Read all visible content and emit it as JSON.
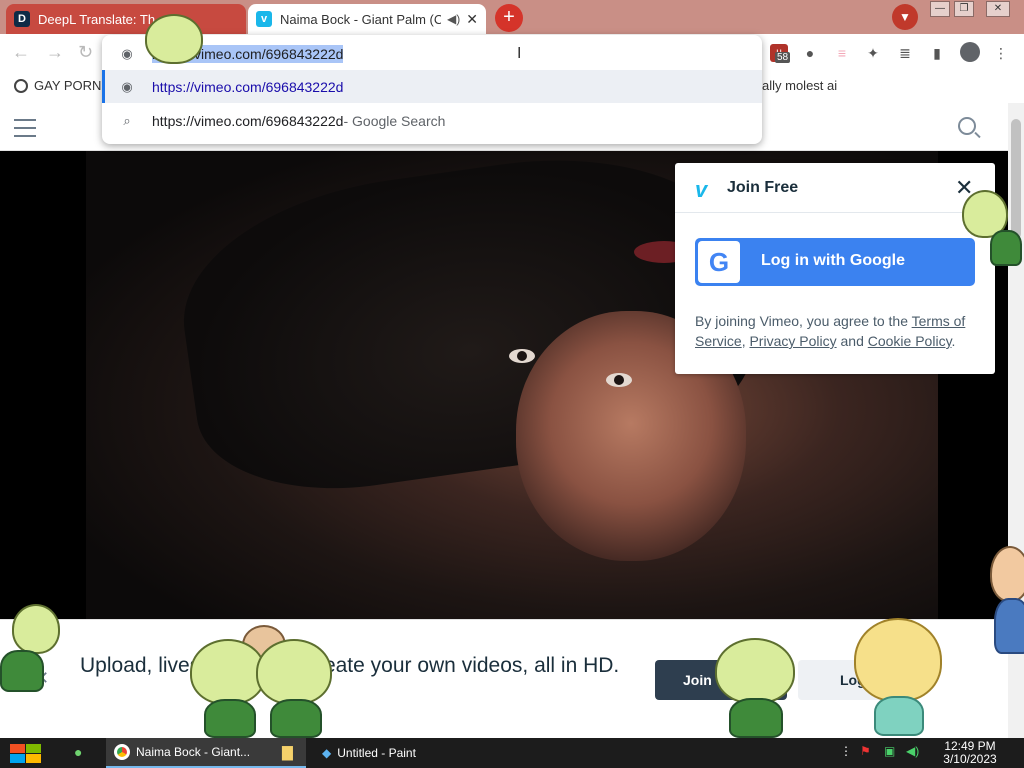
{
  "tabs": [
    {
      "title": "DeepL Translate: Th",
      "favicon": "deepl-icon",
      "active": false
    },
    {
      "title": "Naima Bock - Giant Palm (C",
      "favicon": "vimeo-icon",
      "active": true
    }
  ],
  "omnibox": {
    "input_value": "https://vimeo.com/696843222d",
    "suggestions": [
      {
        "text": "https://vimeo.com/696843222d",
        "suffix": "",
        "icon": "globe-icon"
      },
      {
        "text": "https://vimeo.com/696843222d",
        "suffix": " - Google Search",
        "icon": "search-icon"
      }
    ]
  },
  "extensions": {
    "badge_count": "58"
  },
  "bookmarks": [
    {
      "label": "GAY PORN"
    },
    {
      "label": "ally molest ai"
    }
  ],
  "join_panel": {
    "title": "Join Free",
    "google_button": "Log in with Google",
    "terms_prefix": "By joining Vimeo, you agree to the ",
    "terms_link": "Terms of Service",
    "comma": ", ",
    "privacy_link": "Privacy Policy",
    "and": " and ",
    "cookie_link": "Cookie Policy",
    "period": "."
  },
  "cta": {
    "text": "Upload, livestream, and create your own videos, all in HD.",
    "join": "Join",
    "login": "Log in"
  },
  "taskbar": {
    "items": [
      {
        "label": "Naima Bock - Giant..."
      },
      {
        "label": "Untitled - Paint"
      }
    ],
    "time": "12:49 PM",
    "date": "3/10/2023"
  },
  "colors": {
    "accent": "#1ab7ea",
    "google_blue": "#3b82f0",
    "tabstrip": "#c98f86"
  }
}
